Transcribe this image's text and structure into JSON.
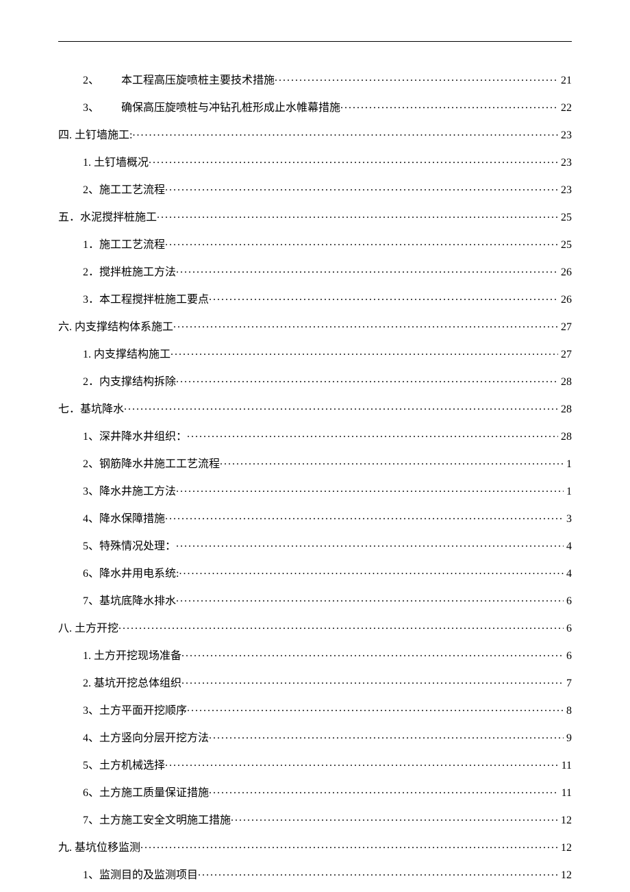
{
  "toc": [
    {
      "level": "lvl2-wide",
      "num": "2、",
      "label": "本工程高压旋喷桩主要技术措施",
      "page": "21"
    },
    {
      "level": "lvl2-wide",
      "num": "3、",
      "label": "确保高压旋喷桩与冲钻孔桩形成止水帷幕措施",
      "page": "22"
    },
    {
      "level": "lvl0",
      "num": "",
      "label": "四. 土钉墙施工:",
      "page": "23"
    },
    {
      "level": "lvl1",
      "num": "",
      "label": "1. 土钉墙概况",
      "page": "23"
    },
    {
      "level": "lvl1",
      "num": "",
      "label": "2、施工工艺流程",
      "page": "23"
    },
    {
      "level": "lvl0",
      "num": "",
      "label": "五．水泥搅拌桩施工",
      "page": "25"
    },
    {
      "level": "lvl1",
      "num": "",
      "label": "1．施工工艺流程",
      "page": "25"
    },
    {
      "level": "lvl1",
      "num": "",
      "label": "2．搅拌桩施工方法",
      "page": "26"
    },
    {
      "level": "lvl1",
      "num": "",
      "label": "3．本工程搅拌桩施工要点",
      "page": "26"
    },
    {
      "level": "lvl0",
      "num": "",
      "label": "六. 内支撑结构体系施工",
      "page": "27"
    },
    {
      "level": "lvl1",
      "num": "",
      "label": "1. 内支撑结构施工",
      "page": "27"
    },
    {
      "level": "lvl1",
      "num": "",
      "label": "2．内支撑结构拆除",
      "page": "28"
    },
    {
      "level": "lvl0",
      "num": "",
      "label": "七．基坑降水",
      "page": "28"
    },
    {
      "level": "lvl1",
      "num": "",
      "label": "1、深井降水井组织：",
      "page": "28"
    },
    {
      "level": "lvl1",
      "num": "",
      "label": "2、钢筋降水井施工工艺流程",
      "page": "1"
    },
    {
      "level": "lvl1",
      "num": "",
      "label": "3、降水井施工方法",
      "page": "1"
    },
    {
      "level": "lvl1",
      "num": "",
      "label": "4、降水保障措施",
      "page": "3"
    },
    {
      "level": "lvl1",
      "num": "",
      "label": "5、特殊情况处理：",
      "page": "4"
    },
    {
      "level": "lvl1",
      "num": "",
      "label": "6、降水井用电系统:",
      "page": "4"
    },
    {
      "level": "lvl1",
      "num": "",
      "label": "7、基坑底降水排水",
      "page": "6"
    },
    {
      "level": "lvl0",
      "num": "",
      "label": "八. 土方开挖",
      "page": "6"
    },
    {
      "level": "lvl1",
      "num": "",
      "label": "1. 土方开挖现场准备",
      "page": "6"
    },
    {
      "level": "lvl1",
      "num": "",
      "label": "2. 基坑开挖总体组织",
      "page": "7"
    },
    {
      "level": "lvl1",
      "num": "",
      "label": "3、土方平面开挖顺序",
      "page": "8"
    },
    {
      "level": "lvl1",
      "num": "",
      "label": "4、土方竖向分层开挖方法",
      "page": "9"
    },
    {
      "level": "lvl1",
      "num": "",
      "label": "5、土方机械选择",
      "page": "11"
    },
    {
      "level": "lvl1",
      "num": "",
      "label": "6、土方施工质量保证措施",
      "page": "11"
    },
    {
      "level": "lvl1",
      "num": "",
      "label": "7、土方施工安全文明施工措施",
      "page": "12"
    },
    {
      "level": "lvl0",
      "num": "",
      "label": "九. 基坑位移监测",
      "page": "12"
    },
    {
      "level": "lvl1",
      "num": "",
      "label": "1、监测目的及监测项目",
      "page": "12"
    }
  ]
}
